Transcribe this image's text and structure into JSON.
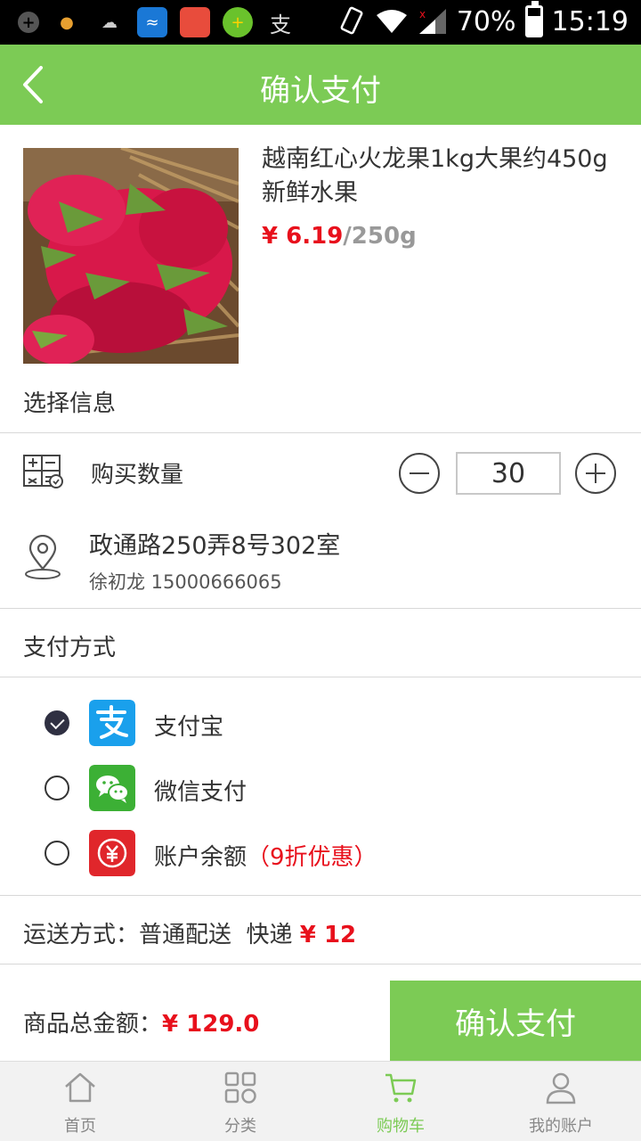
{
  "status_bar": {
    "battery": "70%",
    "time": "15:19"
  },
  "header": {
    "title": "确认支付"
  },
  "product": {
    "name": "越南红心火龙果1kg大果约450g新鲜水果",
    "price": "¥ 6.19",
    "unit": "/250g"
  },
  "select_info": {
    "label": "选择信息"
  },
  "quantity": {
    "label": "购买数量",
    "value": "30"
  },
  "address": {
    "line": "政通路250弄8号302室",
    "contact": "徐初龙 15000666065"
  },
  "payment": {
    "label": "支付方式",
    "options": [
      {
        "label": "支付宝",
        "promo": "",
        "checked": true,
        "icon": "alipay-icon"
      },
      {
        "label": "微信支付",
        "promo": "",
        "checked": false,
        "icon": "wechat-pay-icon"
      },
      {
        "label": "账户余额",
        "promo": "（9折优惠）",
        "checked": false,
        "icon": "balance-icon"
      }
    ]
  },
  "delivery": {
    "text": "运送方式：普通配送  快递",
    "fee": "¥ 12"
  },
  "total": {
    "label": "商品总金额：",
    "amount": "¥ 129.0"
  },
  "confirm_button": "确认支付",
  "bottom_nav": [
    {
      "label": "首页",
      "icon": "home-icon",
      "active": false
    },
    {
      "label": "分类",
      "icon": "category-icon",
      "active": false
    },
    {
      "label": "购物车",
      "icon": "cart-icon",
      "active": true
    },
    {
      "label": "我的账户",
      "icon": "user-icon",
      "active": false
    }
  ],
  "colors": {
    "brand_green": "#7ccb55",
    "price_red": "#e8101c",
    "alipay_blue": "#1aa0ec",
    "wechat_green": "#3cb035",
    "balance_red": "#e0262b"
  }
}
